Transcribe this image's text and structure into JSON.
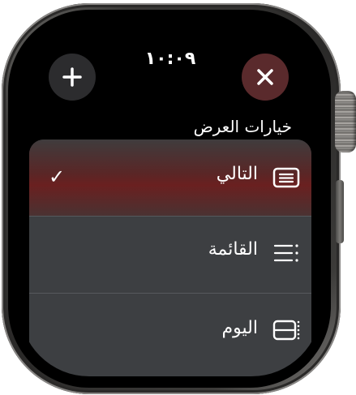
{
  "status": {
    "time": "١٠:٠٩"
  },
  "header": {
    "title": "خيارات العرض"
  },
  "buttons": {
    "add": {
      "icon": "plus-icon"
    },
    "close": {
      "icon": "close-icon"
    }
  },
  "options": [
    {
      "label": "التالي",
      "icon": "next-list-icon",
      "selected": true,
      "check_icon": "checkmark-icon",
      "check_glyph": "✓"
    },
    {
      "label": "القائمة",
      "icon": "list-icon",
      "selected": false
    },
    {
      "label": "اليوم",
      "icon": "day-icon",
      "selected": false
    }
  ],
  "colors": {
    "close_button_bg": "#5a2a2c",
    "add_button_bg": "#2c2c2e",
    "list_bg": "#3d3f42",
    "selected_tint": "#6a2020"
  }
}
